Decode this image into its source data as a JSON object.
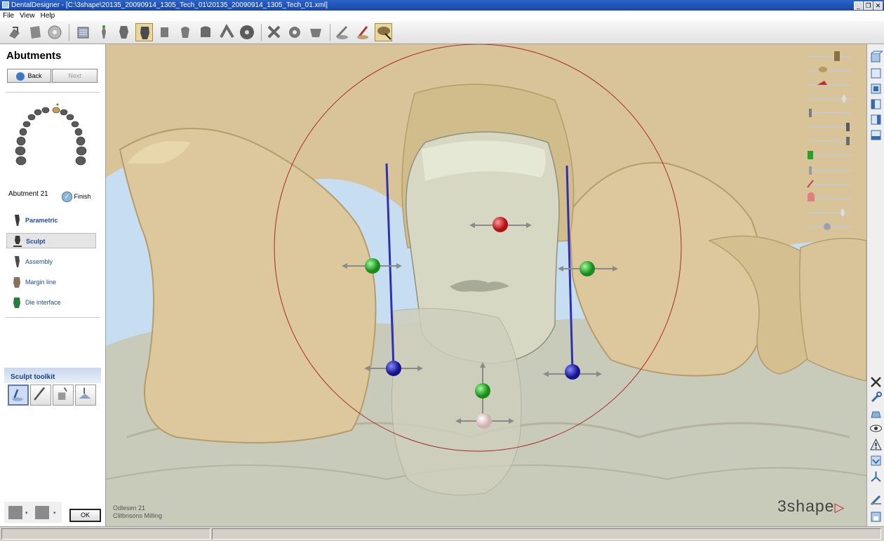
{
  "window": {
    "title": "DentalDesigner - [C:\\3shape\\20135_20090914_1305_Tech_01\\20135_20090914_1305_Tech_01.xml]",
    "min": "_",
    "restore": "❐",
    "close": "✕"
  },
  "menu": [
    "File",
    "View",
    "Help"
  ],
  "toolbar": {
    "groups": [
      [
        "open-order-icon",
        "scan-icon",
        "cd-icon"
      ],
      [
        "model-icon",
        "pen-icon",
        "abutment-icon",
        "crown-icon",
        "bridge-icon",
        "tooth-icon",
        "pontic-icon",
        "jaw-icon",
        "disc-icon"
      ],
      [
        "gear-icon",
        "sculpt-gear-icon",
        "wax-icon"
      ],
      [
        "knife-icon",
        "smooth-icon",
        "cap-icon"
      ]
    ],
    "active": "cap-icon"
  },
  "panel": {
    "title": "Abutments",
    "back_label": "Back",
    "next_label": "Next",
    "abutment_label": "Abutment 21",
    "finish_label": "Finish",
    "steps": [
      "Parametric",
      "Sculpt",
      "Assembly",
      "Margin line",
      "Die interface"
    ],
    "selected_step": "Sculpt",
    "sculpt_toolkit_title": "Sculpt toolkit",
    "sculpt_tools": [
      "smooth-tool-icon",
      "knife-tool-icon",
      "add-material-icon",
      "remove-material-icon"
    ],
    "ok_label": "OK"
  },
  "viewport": {
    "caption_line1": "Odlesen 21",
    "caption_line2": "Clitbnsons Milling",
    "logo": "3shape"
  },
  "colors": {
    "accent": "#1b4a9c",
    "titlebar": "#2b63c8",
    "tooth": "#dcc89c",
    "abutment": "#d6d8c4",
    "sphere_red": "#c01818",
    "sphere_green": "#20a020",
    "sphere_blue": "#1818a0",
    "axis_blue": "#3030b0"
  }
}
